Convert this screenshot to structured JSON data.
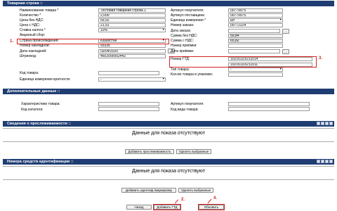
{
  "sections": {
    "goods_row": "Товарная строка ::",
    "additional": "Дополнительные данные ::",
    "tracking": "Сведения о прослеживаемости ::",
    "id_numbers": "Номера средств идентификации ::"
  },
  "left_fields": [
    {
      "label": "Наименование товара *",
      "value": "Тестовая товарная строка 1"
    },
    {
      "label": "Количество *",
      "value": "2,000"
    },
    {
      "label": "Цена без НДС:",
      "value": "59,92"
    },
    {
      "label": "Цена с НДС:",
      "value": "21,91"
    },
    {
      "label": "Ставка налога *",
      "value": "10%"
    },
    {
      "label": "Акцизный сбор:",
      "value": ""
    },
    {
      "label": "Страна происхождения:",
      "value": "Казахстан"
    },
    {
      "label": "Номер накладной:",
      "value": "93335"
    },
    {
      "label": "Дата накладной:",
      "value": "03/04/2020"
    },
    {
      "label": "Штрихкод:",
      "value": "4602000002442"
    },
    {
      "label": "Код товара:",
      "value": ""
    },
    {
      "label": "Единица измерения кратности:",
      "value": "-"
    }
  ],
  "right_fields": [
    {
      "label": "Артикул покупателя:",
      "value": "00779975"
    },
    {
      "label": "Артикул поставщика:",
      "value": "00779975"
    },
    {
      "label": "Единица измерения *",
      "value": "шт"
    },
    {
      "label": "Номер заказа:",
      "value": "00772224"
    },
    {
      "label": "Дата заказа:",
      "value": ""
    },
    {
      "label": "Сумма без НДС:",
      "value": "59,84"
    },
    {
      "label": "Сумма с НДС:",
      "value": "65,82"
    },
    {
      "label": "Номер приёмки:",
      "value": ""
    },
    {
      "label": "Дата приёмки:",
      "value": ""
    },
    {
      "label": "Номер ГТД:",
      "value": "10216110/211014"
    },
    {
      "label": "",
      "value": "10216110/211011"
    },
    {
      "label": "Тип товара:",
      "value": "-"
    },
    {
      "label": "Кол-во товара в упаковке:",
      "value": ""
    }
  ],
  "additional_fields": {
    "left": [
      {
        "label": "Характеристики товара:"
      },
      {
        "label": "Код каталога:"
      }
    ],
    "right": [
      {
        "label": "Артикул покупателя:"
      },
      {
        "label": "Код вида товара:"
      }
    ],
    "kind_value": "-"
  },
  "tracking": {
    "empty_text": "Данные для показа отсутствуют",
    "add_button": "Добавить прослеживаемость",
    "delete_button": "Удалить выбранные"
  },
  "id_numbers": {
    "empty_text": "Данные для показа отсутствуют",
    "add_button": "Добавить идентиф./маркировку",
    "delete_button": "Удалить выбранные"
  },
  "footer": {
    "back_button": "Назад",
    "add_gtd_button": "Добавить ГТД",
    "update_button": "Обновить"
  },
  "annotations": {
    "n1": "1.",
    "n2": "2.",
    "n3": "3.",
    "n4": "4."
  },
  "accent_color": "#1f3d72",
  "highlight_color": "#d62020"
}
